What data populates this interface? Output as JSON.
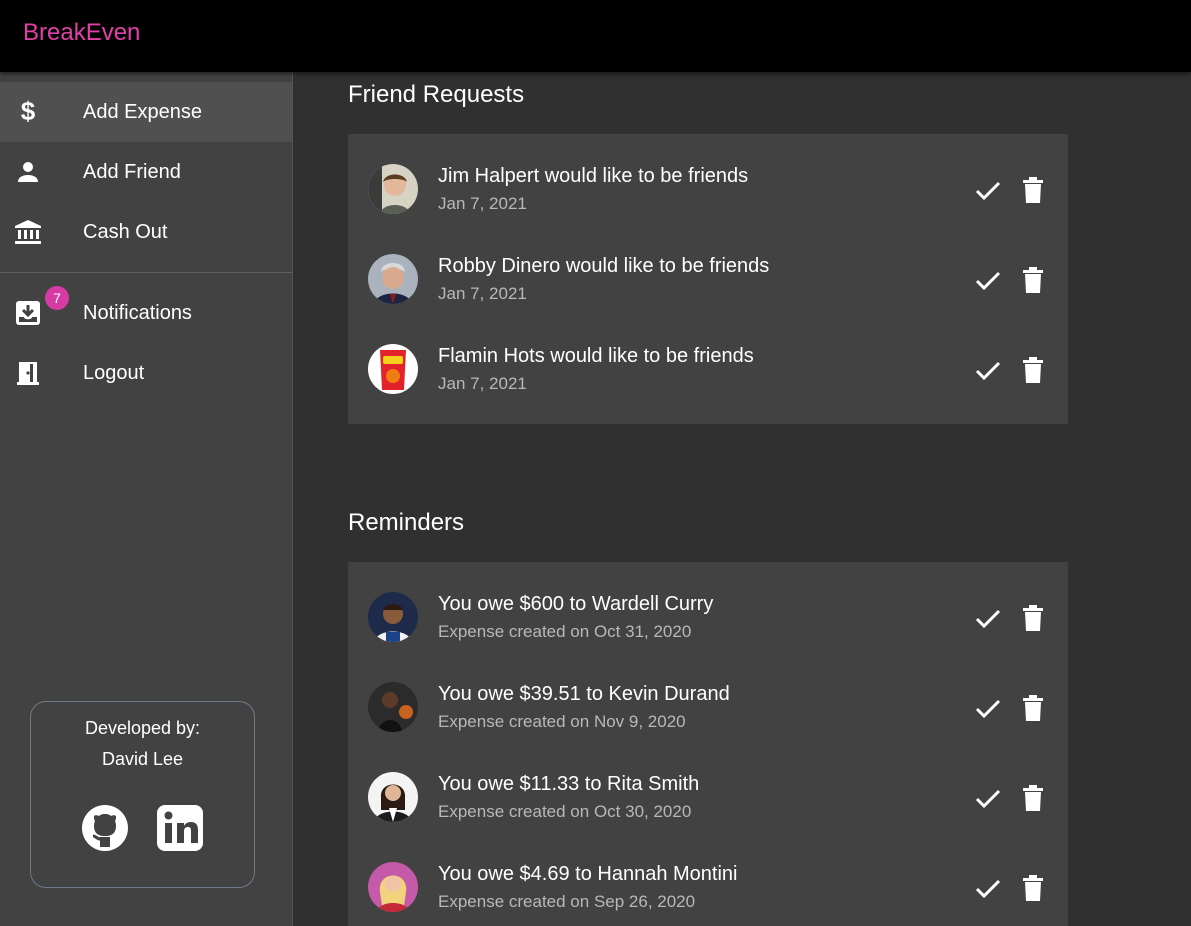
{
  "app": {
    "title": "BreakEven",
    "brand_color": "#e040a8"
  },
  "sidebar": {
    "items": [
      {
        "label": "Add Expense",
        "icon": "dollar-icon"
      },
      {
        "label": "Add Friend",
        "icon": "person-icon"
      },
      {
        "label": "Cash Out",
        "icon": "bank-icon"
      },
      {
        "label": "Notifications",
        "icon": "inbox-icon",
        "badge": "7"
      },
      {
        "label": "Logout",
        "icon": "door-icon"
      }
    ],
    "developer": {
      "title": "Developed by:",
      "name": "David Lee",
      "links": [
        "github-icon",
        "linkedin-icon"
      ]
    }
  },
  "friend_requests": {
    "title": "Friend Requests",
    "items": [
      {
        "text": "Jim Halpert would like to be friends",
        "date": "Jan 7, 2021"
      },
      {
        "text": "Robby Dinero would like to be friends",
        "date": "Jan 7, 2021"
      },
      {
        "text": "Flamin Hots would like to be friends",
        "date": "Jan 7, 2021"
      }
    ]
  },
  "reminders": {
    "title": "Reminders",
    "items": [
      {
        "text": "You owe $600 to Wardell Curry",
        "date": "Expense created on Oct 31, 2020"
      },
      {
        "text": "You owe $39.51 to Kevin Durand",
        "date": "Expense created on Nov 9, 2020"
      },
      {
        "text": "You owe $11.33 to Rita Smith",
        "date": "Expense created on Oct 30, 2020"
      },
      {
        "text": "You owe $4.69 to Hannah Montini",
        "date": "Expense created on Sep 26, 2020"
      }
    ]
  }
}
